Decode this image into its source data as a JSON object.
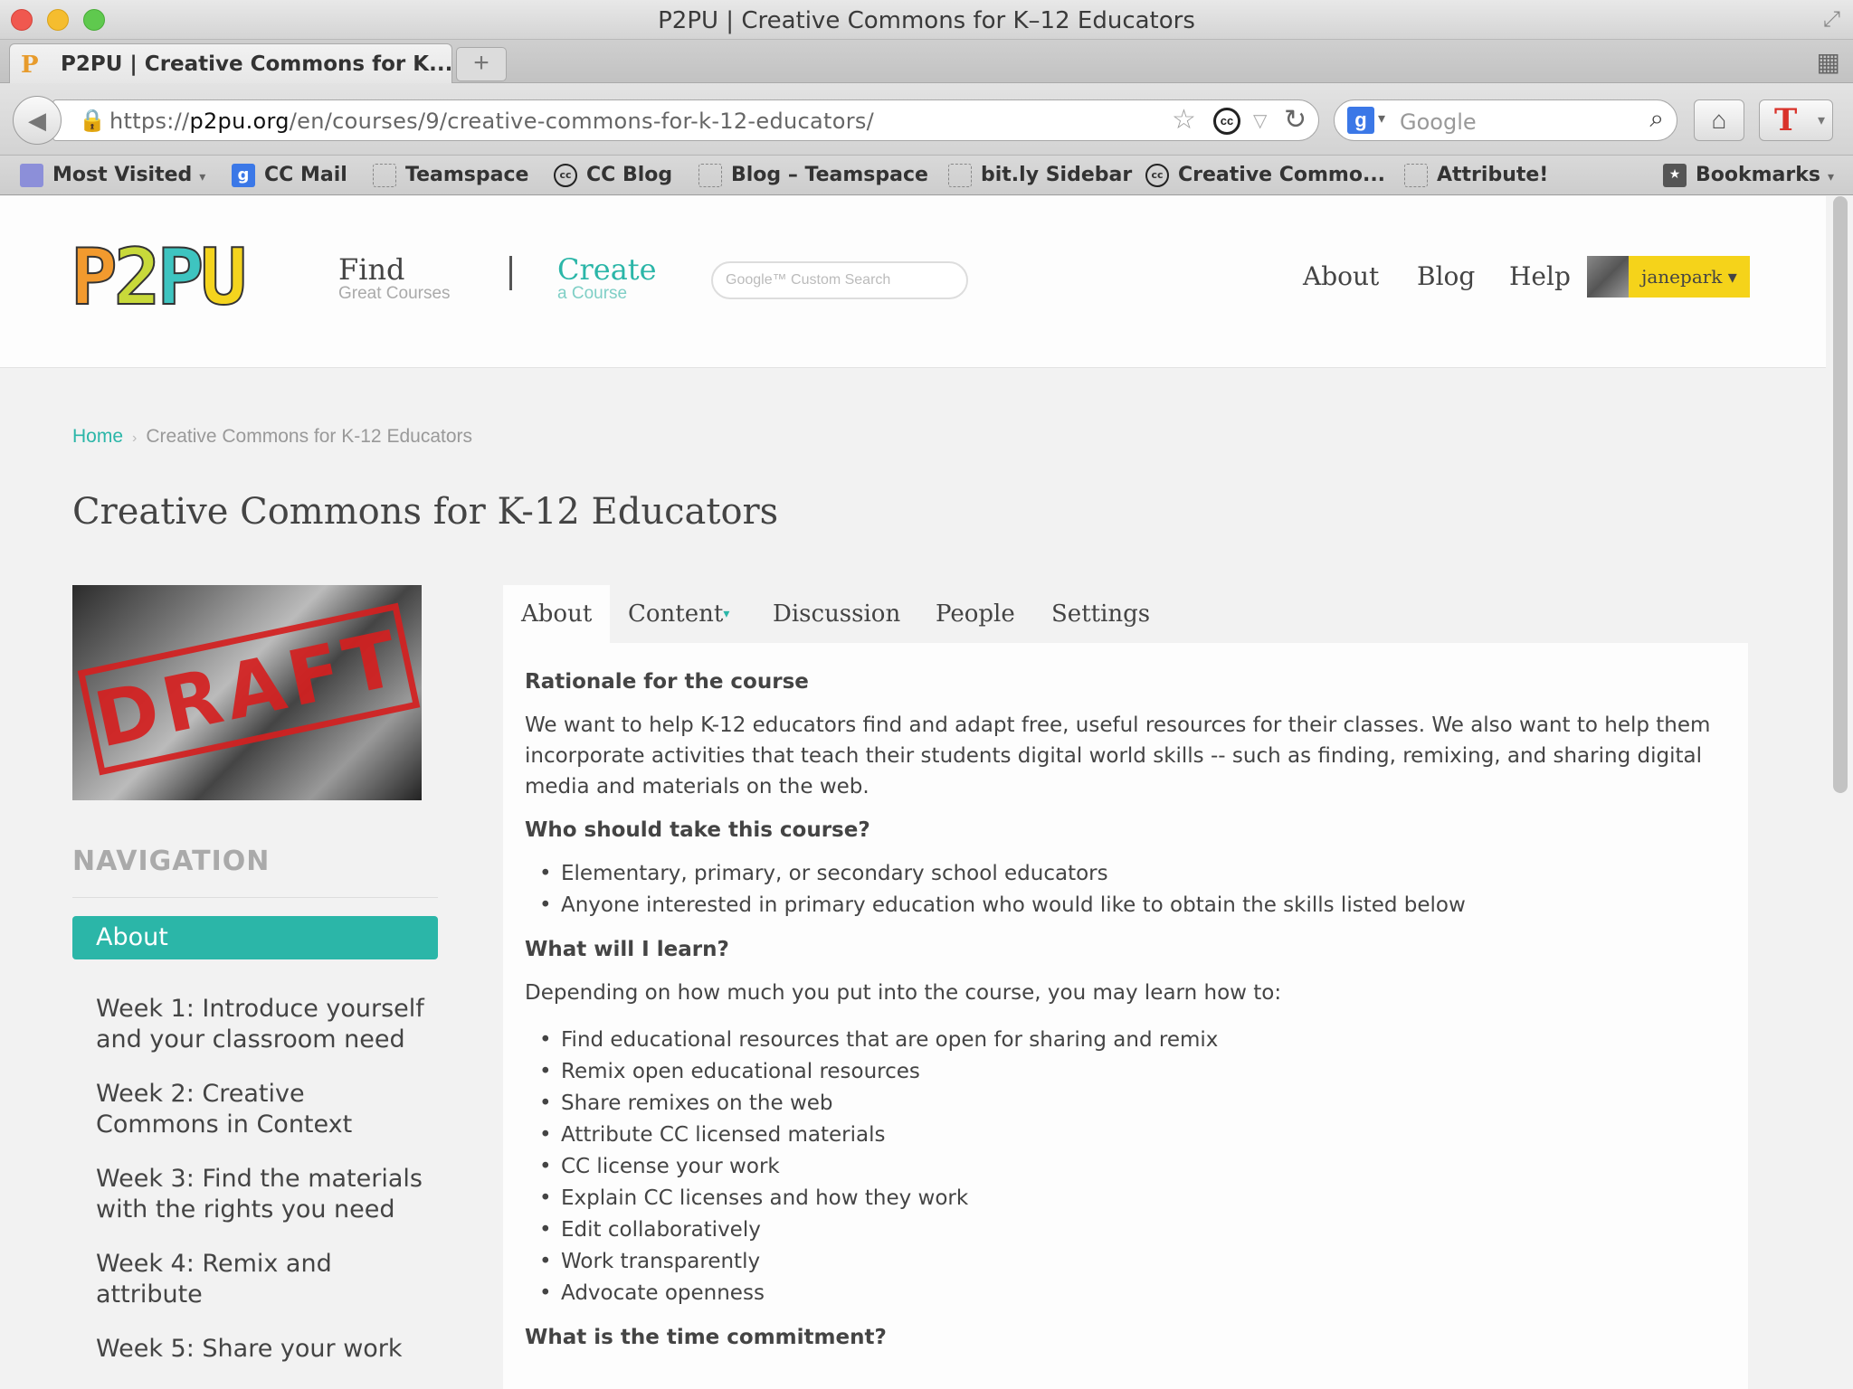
{
  "window": {
    "title": "P2PU | Creative Commons for K–12 Educators",
    "tab_label": "P2PU | Creative Commons for K...",
    "new_tab": "+"
  },
  "navbar": {
    "url_prefix": "https://",
    "url_host": "p2pu.org",
    "url_path": "/en/courses/9/creative-commons-for-k-12-educators/",
    "search_placeholder": "Google"
  },
  "bookmarks": [
    {
      "label": "Most Visited",
      "icon": "folder-icon",
      "dropdown": true
    },
    {
      "label": "CC Mail",
      "icon": "mail-icon"
    },
    {
      "label": "Teamspace",
      "icon": "page-icon"
    },
    {
      "label": "CC Blog",
      "icon": "cc-icon"
    },
    {
      "label": "Blog – Teamspace",
      "icon": "page-icon"
    },
    {
      "label": "bit.ly Sidebar",
      "icon": "page-icon"
    },
    {
      "label": "Creative Commo...",
      "icon": "cc-icon"
    },
    {
      "label": "Attribute!",
      "icon": "page-icon"
    },
    {
      "label": "Bookmarks",
      "icon": "bookmarks-icon",
      "dropdown": true
    }
  ],
  "site": {
    "logo": "P2PU",
    "nav_find": {
      "main": "Find",
      "sub": "Great Courses"
    },
    "nav_create": {
      "main": "Create",
      "sub": "a Course"
    },
    "search_placeholder": "Google™ Custom Search",
    "links": {
      "about": "About",
      "blog": "Blog",
      "help": "Help"
    },
    "user": "janepark ▾",
    "colors": {
      "accent": "#2bb6a8",
      "user_button": "#f5d31a"
    }
  },
  "breadcrumb": {
    "home": "Home",
    "current": "Creative Commons for K-12 Educators"
  },
  "course": {
    "title": "Creative Commons for K-12 Educators",
    "image_stamp": "DRAFT"
  },
  "sidenav": {
    "heading": "NAVIGATION",
    "active": "About",
    "items": [
      "Week 1: Introduce yourself and your classroom need",
      "Week 2: Creative Commons in Context",
      "Week 3: Find the materials with the rights you need",
      "Week 4: Remix and attribute",
      "Week 5: Share your work"
    ]
  },
  "tabs": {
    "about": "About",
    "content": "Content",
    "discussion": "Discussion",
    "people": "People",
    "settings": "Settings"
  },
  "content": {
    "h1": "Rationale for the course",
    "p1": "We want to help K-12 educators find and adapt free, useful resources for their classes. We also want to help them incorporate activities that teach their students digital world skills -- such as finding, remixing, and sharing digital media and materials on the web.",
    "h2": "Who should take this course?",
    "list1": [
      "Elementary, primary, or secondary school educators",
      "Anyone interested in primary education who would like to obtain the skills listed below"
    ],
    "h3": "What will I learn?",
    "p2": "Depending on how much you put into the course, you may learn how to:",
    "list2": [
      "Find educational resources that are open for sharing and remix",
      "Remix open educational resources",
      "Share remixes on the web",
      "Attribute CC licensed materials",
      "CC license your work",
      "Explain CC licenses and how they work",
      "Edit collaboratively",
      "Work transparently",
      "Advocate openness"
    ],
    "h4": "What is the time commitment?"
  }
}
